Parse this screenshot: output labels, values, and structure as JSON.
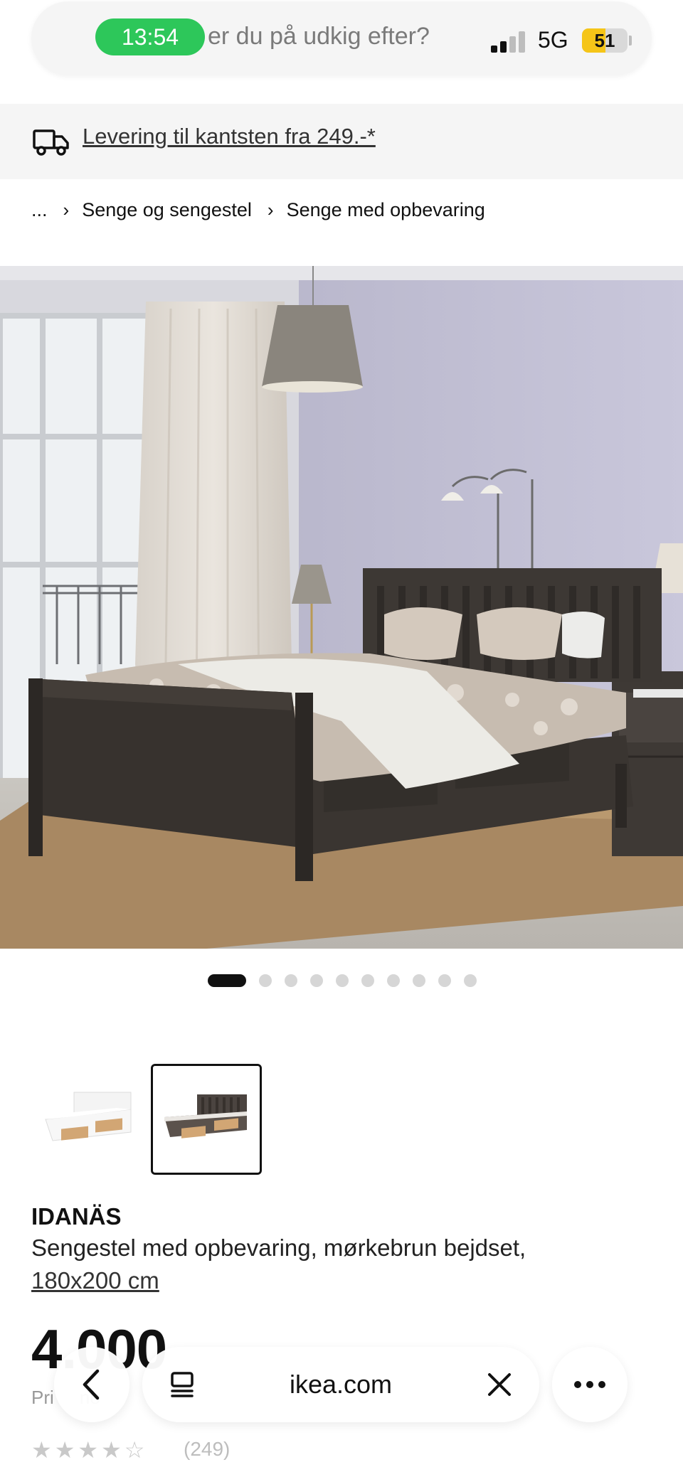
{
  "status_bar": {
    "time": "13:54",
    "network": "5G",
    "battery": "51",
    "battery_level": 0.51
  },
  "search": {
    "text": "er du på udkig efter?"
  },
  "delivery_banner": {
    "text": "Levering til kantsten fra 249.-*",
    "icon": "truck-icon"
  },
  "breadcrumb": {
    "items": [
      "...",
      "Senge og sengestel",
      "Senge med opbevaring"
    ],
    "separator": "›"
  },
  "gallery": {
    "image_count": 10,
    "active_index": 0
  },
  "product": {
    "name": "IDANÄS",
    "description": "Sengestel med opbevaring, mørkebrun bejdset,",
    "size": "180x200 cm",
    "price": "4.000",
    "price_note": "Pri       no",
    "rating_stars": 4.5,
    "review_count": "(249)"
  },
  "browser": {
    "url": "ikea.com",
    "back_icon": "back-arrow-icon",
    "tabs_icon": "tab-list-icon",
    "close_icon": "close-icon",
    "more_icon": "more-dots-icon"
  },
  "colors": {
    "time_pill": "#2dc75a",
    "battery_fill": "#f5c518",
    "banner_bg": "#f5f5f5"
  }
}
